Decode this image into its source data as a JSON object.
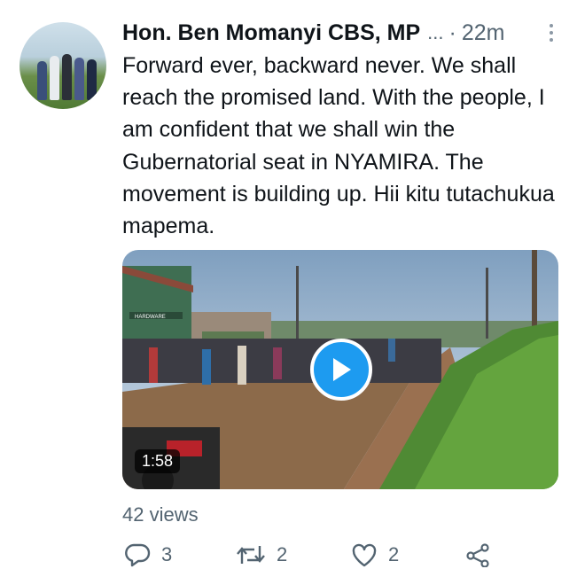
{
  "tweet": {
    "author_name": "Hon. Ben Momanyi CBS, MP",
    "handle_truncated": "...",
    "separator": "·",
    "time": "22m",
    "text": "Forward ever, backward never. We shall reach the promised land. With the people, I am confident that we shall win the Gubernatorial seat in NYAMIRA. The movement is building up. Hii kitu tutachukua mapema.",
    "video": {
      "duration": "1:58",
      "sign_text": "HARDWARE"
    },
    "views": "42 views",
    "actions": {
      "reply_count": "3",
      "retweet_count": "2",
      "like_count": "2"
    }
  },
  "icons": [
    "more-icon",
    "play-icon",
    "reply-icon",
    "retweet-icon",
    "like-icon",
    "share-icon"
  ],
  "colors": {
    "text": "#0f1419",
    "secondary": "#536471",
    "accent": "#1d9bf0"
  }
}
